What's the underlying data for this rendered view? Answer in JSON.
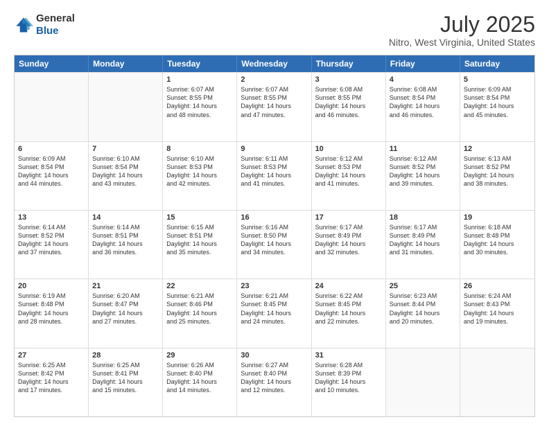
{
  "header": {
    "logo_general": "General",
    "logo_blue": "Blue",
    "month_year": "July 2025",
    "location": "Nitro, West Virginia, United States"
  },
  "calendar": {
    "days_of_week": [
      "Sunday",
      "Monday",
      "Tuesday",
      "Wednesday",
      "Thursday",
      "Friday",
      "Saturday"
    ],
    "rows": [
      [
        {
          "day": "",
          "lines": [],
          "empty": true
        },
        {
          "day": "",
          "lines": [],
          "empty": true
        },
        {
          "day": "1",
          "lines": [
            "Sunrise: 6:07 AM",
            "Sunset: 8:55 PM",
            "Daylight: 14 hours",
            "and 48 minutes."
          ]
        },
        {
          "day": "2",
          "lines": [
            "Sunrise: 6:07 AM",
            "Sunset: 8:55 PM",
            "Daylight: 14 hours",
            "and 47 minutes."
          ]
        },
        {
          "day": "3",
          "lines": [
            "Sunrise: 6:08 AM",
            "Sunset: 8:55 PM",
            "Daylight: 14 hours",
            "and 46 minutes."
          ]
        },
        {
          "day": "4",
          "lines": [
            "Sunrise: 6:08 AM",
            "Sunset: 8:54 PM",
            "Daylight: 14 hours",
            "and 46 minutes."
          ]
        },
        {
          "day": "5",
          "lines": [
            "Sunrise: 6:09 AM",
            "Sunset: 8:54 PM",
            "Daylight: 14 hours",
            "and 45 minutes."
          ]
        }
      ],
      [
        {
          "day": "6",
          "lines": [
            "Sunrise: 6:09 AM",
            "Sunset: 8:54 PM",
            "Daylight: 14 hours",
            "and 44 minutes."
          ]
        },
        {
          "day": "7",
          "lines": [
            "Sunrise: 6:10 AM",
            "Sunset: 8:54 PM",
            "Daylight: 14 hours",
            "and 43 minutes."
          ]
        },
        {
          "day": "8",
          "lines": [
            "Sunrise: 6:10 AM",
            "Sunset: 8:53 PM",
            "Daylight: 14 hours",
            "and 42 minutes."
          ]
        },
        {
          "day": "9",
          "lines": [
            "Sunrise: 6:11 AM",
            "Sunset: 8:53 PM",
            "Daylight: 14 hours",
            "and 41 minutes."
          ]
        },
        {
          "day": "10",
          "lines": [
            "Sunrise: 6:12 AM",
            "Sunset: 8:53 PM",
            "Daylight: 14 hours",
            "and 41 minutes."
          ]
        },
        {
          "day": "11",
          "lines": [
            "Sunrise: 6:12 AM",
            "Sunset: 8:52 PM",
            "Daylight: 14 hours",
            "and 39 minutes."
          ]
        },
        {
          "day": "12",
          "lines": [
            "Sunrise: 6:13 AM",
            "Sunset: 8:52 PM",
            "Daylight: 14 hours",
            "and 38 minutes."
          ]
        }
      ],
      [
        {
          "day": "13",
          "lines": [
            "Sunrise: 6:14 AM",
            "Sunset: 8:52 PM",
            "Daylight: 14 hours",
            "and 37 minutes."
          ]
        },
        {
          "day": "14",
          "lines": [
            "Sunrise: 6:14 AM",
            "Sunset: 8:51 PM",
            "Daylight: 14 hours",
            "and 36 minutes."
          ]
        },
        {
          "day": "15",
          "lines": [
            "Sunrise: 6:15 AM",
            "Sunset: 8:51 PM",
            "Daylight: 14 hours",
            "and 35 minutes."
          ]
        },
        {
          "day": "16",
          "lines": [
            "Sunrise: 6:16 AM",
            "Sunset: 8:50 PM",
            "Daylight: 14 hours",
            "and 34 minutes."
          ]
        },
        {
          "day": "17",
          "lines": [
            "Sunrise: 6:17 AM",
            "Sunset: 8:49 PM",
            "Daylight: 14 hours",
            "and 32 minutes."
          ]
        },
        {
          "day": "18",
          "lines": [
            "Sunrise: 6:17 AM",
            "Sunset: 8:49 PM",
            "Daylight: 14 hours",
            "and 31 minutes."
          ]
        },
        {
          "day": "19",
          "lines": [
            "Sunrise: 6:18 AM",
            "Sunset: 8:48 PM",
            "Daylight: 14 hours",
            "and 30 minutes."
          ]
        }
      ],
      [
        {
          "day": "20",
          "lines": [
            "Sunrise: 6:19 AM",
            "Sunset: 8:48 PM",
            "Daylight: 14 hours",
            "and 28 minutes."
          ]
        },
        {
          "day": "21",
          "lines": [
            "Sunrise: 6:20 AM",
            "Sunset: 8:47 PM",
            "Daylight: 14 hours",
            "and 27 minutes."
          ]
        },
        {
          "day": "22",
          "lines": [
            "Sunrise: 6:21 AM",
            "Sunset: 8:46 PM",
            "Daylight: 14 hours",
            "and 25 minutes."
          ]
        },
        {
          "day": "23",
          "lines": [
            "Sunrise: 6:21 AM",
            "Sunset: 8:45 PM",
            "Daylight: 14 hours",
            "and 24 minutes."
          ]
        },
        {
          "day": "24",
          "lines": [
            "Sunrise: 6:22 AM",
            "Sunset: 8:45 PM",
            "Daylight: 14 hours",
            "and 22 minutes."
          ]
        },
        {
          "day": "25",
          "lines": [
            "Sunrise: 6:23 AM",
            "Sunset: 8:44 PM",
            "Daylight: 14 hours",
            "and 20 minutes."
          ]
        },
        {
          "day": "26",
          "lines": [
            "Sunrise: 6:24 AM",
            "Sunset: 8:43 PM",
            "Daylight: 14 hours",
            "and 19 minutes."
          ]
        }
      ],
      [
        {
          "day": "27",
          "lines": [
            "Sunrise: 6:25 AM",
            "Sunset: 8:42 PM",
            "Daylight: 14 hours",
            "and 17 minutes."
          ]
        },
        {
          "day": "28",
          "lines": [
            "Sunrise: 6:25 AM",
            "Sunset: 8:41 PM",
            "Daylight: 14 hours",
            "and 15 minutes."
          ]
        },
        {
          "day": "29",
          "lines": [
            "Sunrise: 6:26 AM",
            "Sunset: 8:40 PM",
            "Daylight: 14 hours",
            "and 14 minutes."
          ]
        },
        {
          "day": "30",
          "lines": [
            "Sunrise: 6:27 AM",
            "Sunset: 8:40 PM",
            "Daylight: 14 hours",
            "and 12 minutes."
          ]
        },
        {
          "day": "31",
          "lines": [
            "Sunrise: 6:28 AM",
            "Sunset: 8:39 PM",
            "Daylight: 14 hours",
            "and 10 minutes."
          ]
        },
        {
          "day": "",
          "lines": [],
          "empty": true
        },
        {
          "day": "",
          "lines": [],
          "empty": true
        }
      ]
    ]
  }
}
